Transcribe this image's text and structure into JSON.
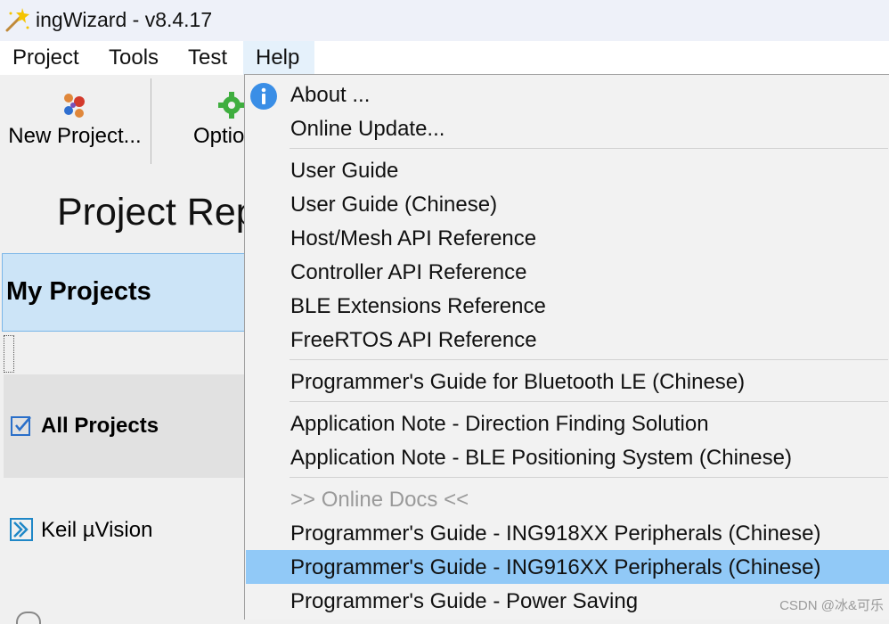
{
  "window": {
    "title": "ingWizard - v8.4.17"
  },
  "menubar": {
    "items": [
      "Project",
      "Tools",
      "Test",
      "Help"
    ]
  },
  "toolbar": {
    "new_project": "New Project...",
    "options_partial": "Optio"
  },
  "page": {
    "title_partial": "Project Rep"
  },
  "left_panel": {
    "my_projects": "My Projects",
    "all_projects": "All Projects",
    "keil": "Keil µVision"
  },
  "help_menu": {
    "items": [
      {
        "label": "About ...",
        "state": "normal"
      },
      {
        "label": "Online Update...",
        "state": "normal"
      },
      {
        "label": "User Guide",
        "state": "normal"
      },
      {
        "label": "User Guide (Chinese)",
        "state": "normal"
      },
      {
        "label": "Host/Mesh API Reference",
        "state": "normal"
      },
      {
        "label": "Controller API Reference",
        "state": "normal"
      },
      {
        "label": "BLE Extensions Reference",
        "state": "normal"
      },
      {
        "label": "FreeRTOS API Reference",
        "state": "normal"
      },
      {
        "label": "Programmer's Guide for Bluetooth LE (Chinese)",
        "state": "normal"
      },
      {
        "label": "Application Note - Direction Finding Solution",
        "state": "normal"
      },
      {
        "label": "Application Note - BLE Positioning System (Chinese)",
        "state": "normal"
      },
      {
        "label": ">> Online Docs <<",
        "state": "disabled"
      },
      {
        "label": "Programmer's Guide - ING918XX Peripherals (Chinese)",
        "state": "normal"
      },
      {
        "label": "Programmer's Guide - ING916XX Peripherals (Chinese)",
        "state": "highlighted"
      },
      {
        "label": "Programmer's Guide - Power Saving",
        "state": "normal"
      }
    ]
  },
  "watermark": "CSDN @冰&可乐",
  "colors": {
    "highlight": "#91c9f7",
    "selected_panel": "#cce4f7",
    "menu_open": "#e5f1fb",
    "info_icon": "#3a8ee6"
  }
}
